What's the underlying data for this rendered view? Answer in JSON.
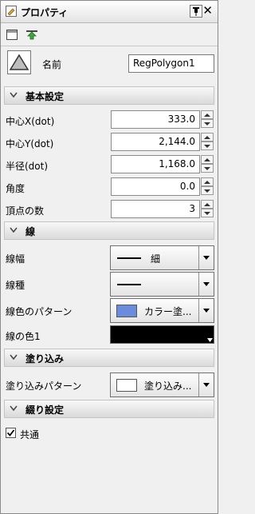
{
  "panel": {
    "title": "プロパティ"
  },
  "object": {
    "name_label": "名前",
    "name_value": "RegPolygon1"
  },
  "sections": {
    "basic": "基本設定",
    "line": "線",
    "fill": "塗り込み",
    "hatch": "綴り設定"
  },
  "basic_fields": {
    "center_x": {
      "label": "中心X(dot)",
      "value": "333.0"
    },
    "center_y": {
      "label": "中心Y(dot)",
      "value": "2,144.0"
    },
    "radius": {
      "label": "半径(dot)",
      "value": "1,168.0"
    },
    "angle": {
      "label": "角度",
      "value": "0.0"
    },
    "vertices": {
      "label": "頂点の数",
      "value": "3"
    }
  },
  "line_fields": {
    "width": {
      "label": "線幅",
      "value": "細"
    },
    "type": {
      "label": "線種"
    },
    "color_pattern": {
      "label": "線色のパターン",
      "value": "カラー塗..."
    },
    "color1": {
      "label": "線の色1"
    }
  },
  "fill_fields": {
    "pattern": {
      "label": "塗り込みパターン",
      "value": "塗り込み..."
    }
  },
  "hatch_fields": {
    "common": {
      "label": "共通",
      "checked": true
    }
  },
  "colors": {
    "line_pattern_swatch": "#6b8cdc",
    "line_color1": "#000000",
    "fill_swatch": "#ffffff"
  },
  "icons": {
    "title": "properties-icon",
    "pin": "pin-icon",
    "close": "close-icon",
    "rect": "rectangle-icon",
    "apply": "green-arrow-icon",
    "shape": "triangle-shape-icon"
  }
}
